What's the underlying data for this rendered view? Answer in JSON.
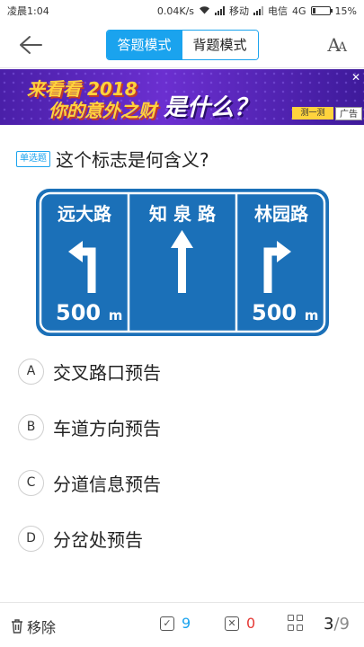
{
  "status_bar": {
    "time": "凌晨1:04",
    "net_speed": "0.04K/s",
    "carrier1": "移动",
    "carrier2": "电信",
    "network": "4G",
    "battery": "15%",
    "battery_level": 0.15
  },
  "header": {
    "modes": [
      "答题模式",
      "背题模式"
    ],
    "active_mode": "答题模式",
    "font_icon": "font-size-icon"
  },
  "ad": {
    "line1": "来看看 2018",
    "line2": "你的意外之财",
    "line3": "是什么？",
    "cta": "测一测",
    "label": "广告",
    "close": "✕"
  },
  "question": {
    "type_label": "单选题",
    "text": "这个标志是何含义?"
  },
  "sign": {
    "panels": [
      {
        "road": "远大路",
        "arrow": "turn-left",
        "distance": "500",
        "unit": "m"
      },
      {
        "road": "知 泉 路",
        "arrow": "straight",
        "distance": "",
        "unit": ""
      },
      {
        "road": "林园路",
        "arrow": "turn-right",
        "distance": "500",
        "unit": "m"
      }
    ],
    "colors": {
      "background": "#1b70b8",
      "border": "#ffffff"
    }
  },
  "options": [
    {
      "letter": "A",
      "text": "交叉路口预告"
    },
    {
      "letter": "B",
      "text": "车道方向预告"
    },
    {
      "letter": "C",
      "text": "分道信息预告"
    },
    {
      "letter": "D",
      "text": "分岔处预告"
    }
  ],
  "bottom_bar": {
    "remove_label": "移除",
    "correct_count": "9",
    "wrong_count": "0",
    "current": "3",
    "total": "/9"
  },
  "colors": {
    "accent": "#1aa3ee",
    "wrong": "#e53935"
  }
}
